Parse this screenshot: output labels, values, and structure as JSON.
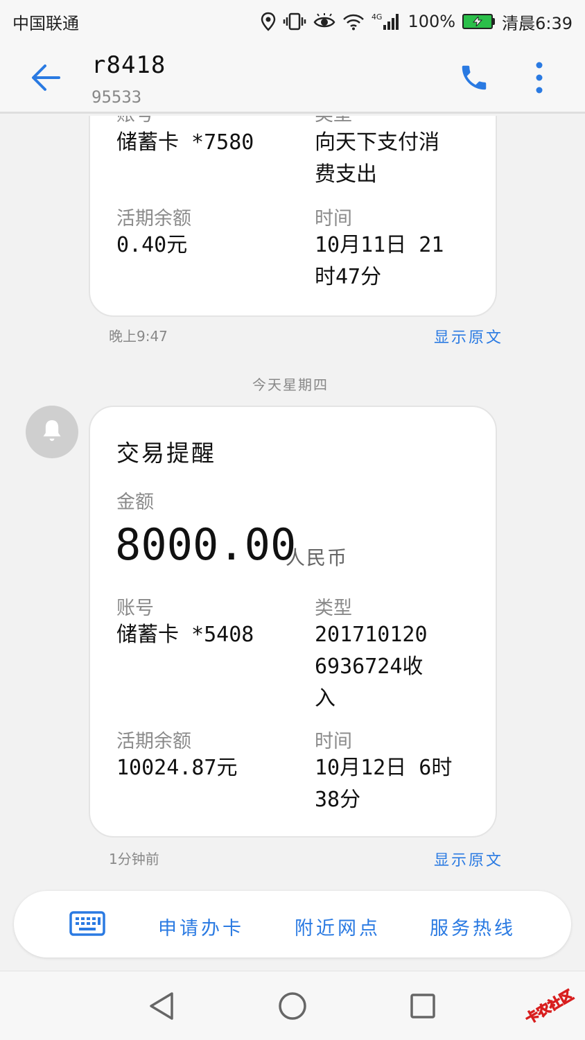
{
  "status_bar": {
    "carrier": "中国联通",
    "network_badge": "4G",
    "battery_percent": "100%",
    "time": "清晨6:39",
    "icons": [
      "location-icon",
      "vibrate-icon",
      "eye-comfort-icon",
      "wifi-icon",
      "signal-icon",
      "battery-icon"
    ]
  },
  "header": {
    "title": "r8418",
    "subtitle": "95533",
    "icons": [
      "back-arrow-icon",
      "phone-icon",
      "more-vertical-icon"
    ]
  },
  "message1": {
    "account_label_partial": "账号",
    "account_value": "储蓄卡 *7580",
    "type_label_partial": "类型",
    "type_value_line1": "向天下支付消",
    "type_value_line2": "费支出",
    "balance_label": "活期余额",
    "balance_value": "0.40元",
    "time_label": "时间",
    "time_value_line1": "10月11日 21",
    "time_value_line2": "时47分",
    "timestamp": "晚上9:47",
    "show_original": "显示原文"
  },
  "date_divider": "今天星期四",
  "message2": {
    "avatar_icon": "bell-icon",
    "title": "交易提醒",
    "amount_label": "金额",
    "amount": "8000.00",
    "currency": "人民币",
    "account_label": "账号",
    "account_value": "储蓄卡 *5408",
    "type_label": "类型",
    "type_value_line1": "201710120",
    "type_value_line2": "6936724收",
    "type_value_line3": "入",
    "balance_label": "活期余额",
    "balance_value": "10024.87元",
    "time_label": "时间",
    "time_value_line1": "10月12日 6时",
    "time_value_line2": "38分",
    "timestamp": "1分钟前",
    "show_original": "显示原文"
  },
  "quick_menu": {
    "keyboard_icon": "keyboard-icon",
    "items": [
      "申请办卡",
      "附近网点",
      "服务热线"
    ]
  },
  "nav_bar": {
    "icons": [
      "nav-back-icon",
      "nav-home-icon",
      "nav-recents-icon"
    ]
  },
  "watermark": {
    "text": "卡农社区"
  },
  "colors": {
    "accent": "#2a7ae2",
    "battery": "#2bbf4a",
    "background": "#f2f2f2"
  }
}
